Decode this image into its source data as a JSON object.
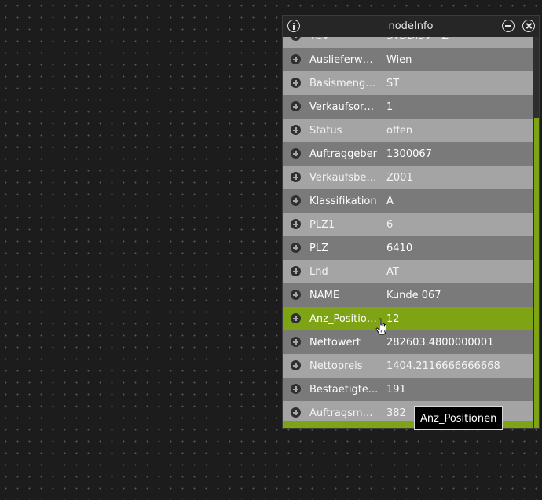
{
  "window": {
    "title": "nodeInfo"
  },
  "rows": [
    {
      "key": "TCV",
      "value": "STDDISV - Z",
      "shade": "light"
    },
    {
      "key": "Auslieferwerk",
      "value": "Wien",
      "shade": "dark"
    },
    {
      "key": "Basismengen...",
      "value": "ST",
      "shade": "light"
    },
    {
      "key": "Verkaufsorga...",
      "value": "1",
      "shade": "dark"
    },
    {
      "key": "Status",
      "value": "offen",
      "shade": "light"
    },
    {
      "key": "Auftraggeber",
      "value": "1300067",
      "shade": "dark"
    },
    {
      "key": "Verkaufsbele...",
      "value": "Z001",
      "shade": "light"
    },
    {
      "key": "Klassifikation",
      "value": "A",
      "shade": "dark"
    },
    {
      "key": "PLZ1",
      "value": "6",
      "shade": "light"
    },
    {
      "key": "PLZ",
      "value": "6410",
      "shade": "dark"
    },
    {
      "key": "Lnd",
      "value": "AT",
      "shade": "light"
    },
    {
      "key": "NAME",
      "value": "Kunde 067",
      "shade": "dark"
    },
    {
      "key": "Anz_Position...",
      "value": "12",
      "shade": "active"
    },
    {
      "key": "Nettowert",
      "value": "282603.4800000001",
      "shade": "dark"
    },
    {
      "key": "Nettopreis",
      "value": "1404.2116666666668",
      "shade": "light"
    },
    {
      "key": "Bestaetigte...",
      "value": "191",
      "shade": "dark"
    },
    {
      "key": "Auftragsmen...",
      "value": "382",
      "shade": "light"
    }
  ],
  "tooltip": {
    "text": "Anz_Positionen"
  },
  "icons": {
    "info": "info-icon",
    "minimize": "minimize-icon",
    "close": "close-icon",
    "expand": "plus-circle-icon",
    "cursor": "hand-pointer-icon"
  },
  "colors": {
    "background": "#1c1c1c",
    "titlebar": "#262626",
    "row_dark": "#7a7a7a",
    "row_light": "#a4a4a4",
    "accent_green": "#7ea315",
    "tooltip_bg": "#000000"
  }
}
